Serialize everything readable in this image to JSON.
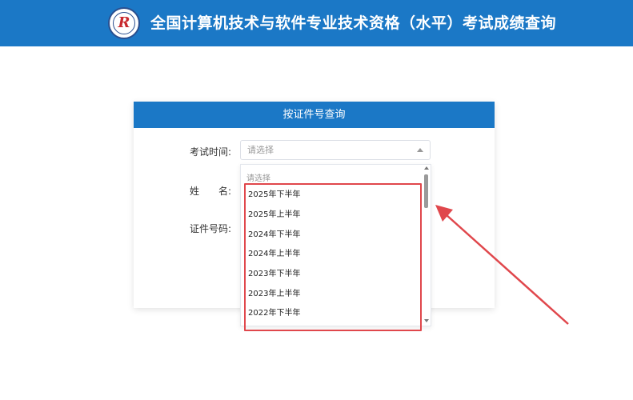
{
  "header": {
    "title": "全国计算机技术与软件专业技术资格（水平）考试成绩查询",
    "logo_icon": "ruankao-emblem-icon",
    "color": "#1b78c6"
  },
  "form": {
    "heading": "按证件号查询",
    "exam_time_label": "考试时间:",
    "name_label_1": "姓",
    "name_label_2": "名:",
    "id_label": "证件号码:",
    "select_placeholder": "请选择"
  },
  "dropdown": {
    "placeholder": "请选择",
    "options": [
      "2025年下半年",
      "2025年上半年",
      "2024年下半年",
      "2024年上半年",
      "2023年下半年",
      "2023年上半年",
      "2022年下半年"
    ],
    "highlight_color": "#e0474c"
  },
  "annotation": {
    "arrow_color": "#e0474c"
  }
}
